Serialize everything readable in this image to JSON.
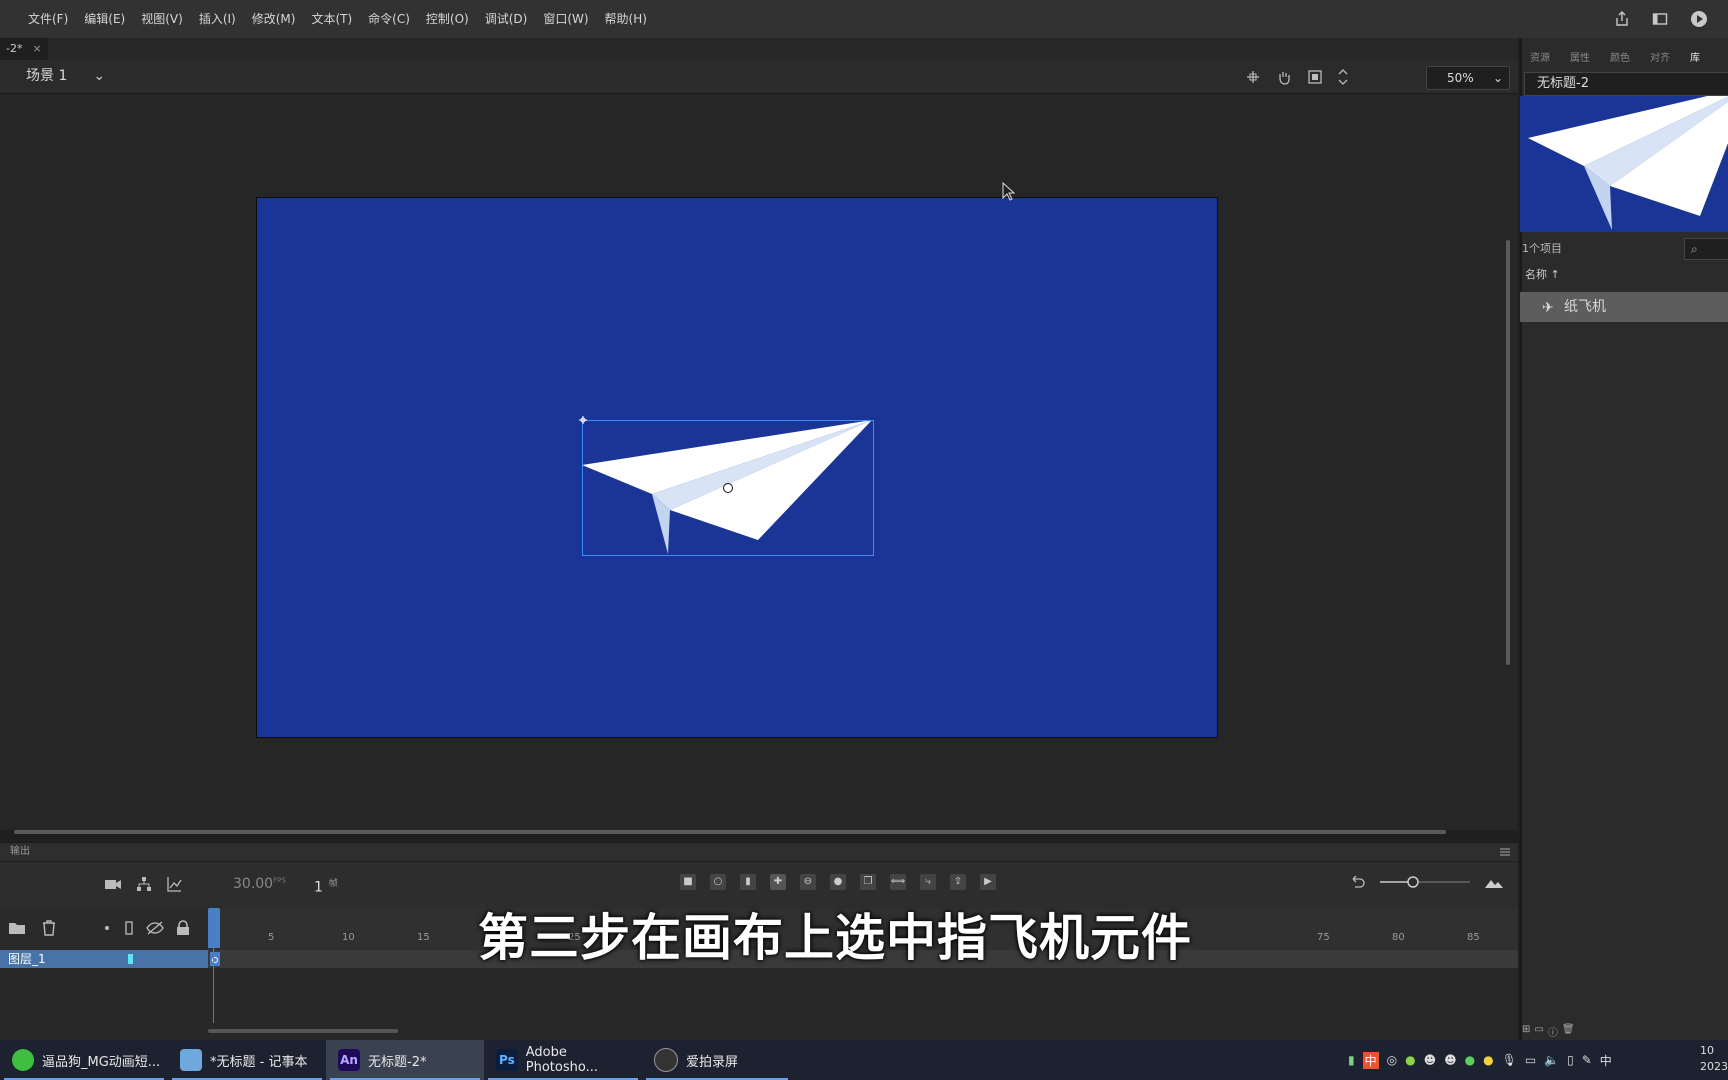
{
  "menubar": {
    "items": [
      "文件(F)",
      "编辑(E)",
      "视图(V)",
      "插入(I)",
      "修改(M)",
      "文本(T)",
      "命令(C)",
      "控制(O)",
      "调试(D)",
      "窗口(W)",
      "帮助(H)"
    ],
    "icons": [
      "share-icon",
      "layout-icon",
      "play-circle-icon"
    ]
  },
  "doc_tab": {
    "label": "-2*",
    "close": "×"
  },
  "scene": {
    "label": "场景 1",
    "chevron": "⌄"
  },
  "zoom": {
    "value": "50%",
    "chevron": "⌄"
  },
  "stage": {
    "background": "#1b3597",
    "selection_color": "#3f8cff"
  },
  "output": {
    "label": "输出"
  },
  "timeline": {
    "fps": "30.00",
    "fps_unit": "FPS",
    "frame": "1",
    "frame_unit": "帧",
    "ruler_ticks": [
      "5",
      "10",
      "15",
      "25",
      "75",
      "80",
      "85"
    ],
    "layer_name": "图层_1"
  },
  "subtitle": "第三步在画布上选中指飞机元件",
  "right_panel": {
    "tabs": [
      "资源",
      "属性",
      "颜色",
      "对齐",
      "库"
    ],
    "library_doc": "无标题-2",
    "item_count": "1个项目",
    "name_header": "名称 ↑",
    "items": [
      {
        "name": "纸飞机"
      }
    ]
  },
  "taskbar": {
    "tasks": [
      {
        "label": "逼品狗_MG动画短...",
        "icon": "leaf-icon",
        "color": "#3fbf3f"
      },
      {
        "label": "*无标题 - 记事本",
        "icon": "notepad-icon",
        "color": "#6fa8dc"
      },
      {
        "label": "无标题-2*",
        "icon": "An",
        "color": "#1f0a5a"
      },
      {
        "label": "Adobe Photosho...",
        "icon": "Ps",
        "color": "#0b1e3f"
      },
      {
        "label": "爱拍录屏",
        "icon": "kangaroo-icon",
        "color": "#333333"
      }
    ],
    "tray_ime": "中",
    "tray_ime2": "中",
    "clock_time": "10",
    "clock_date": "2023"
  }
}
